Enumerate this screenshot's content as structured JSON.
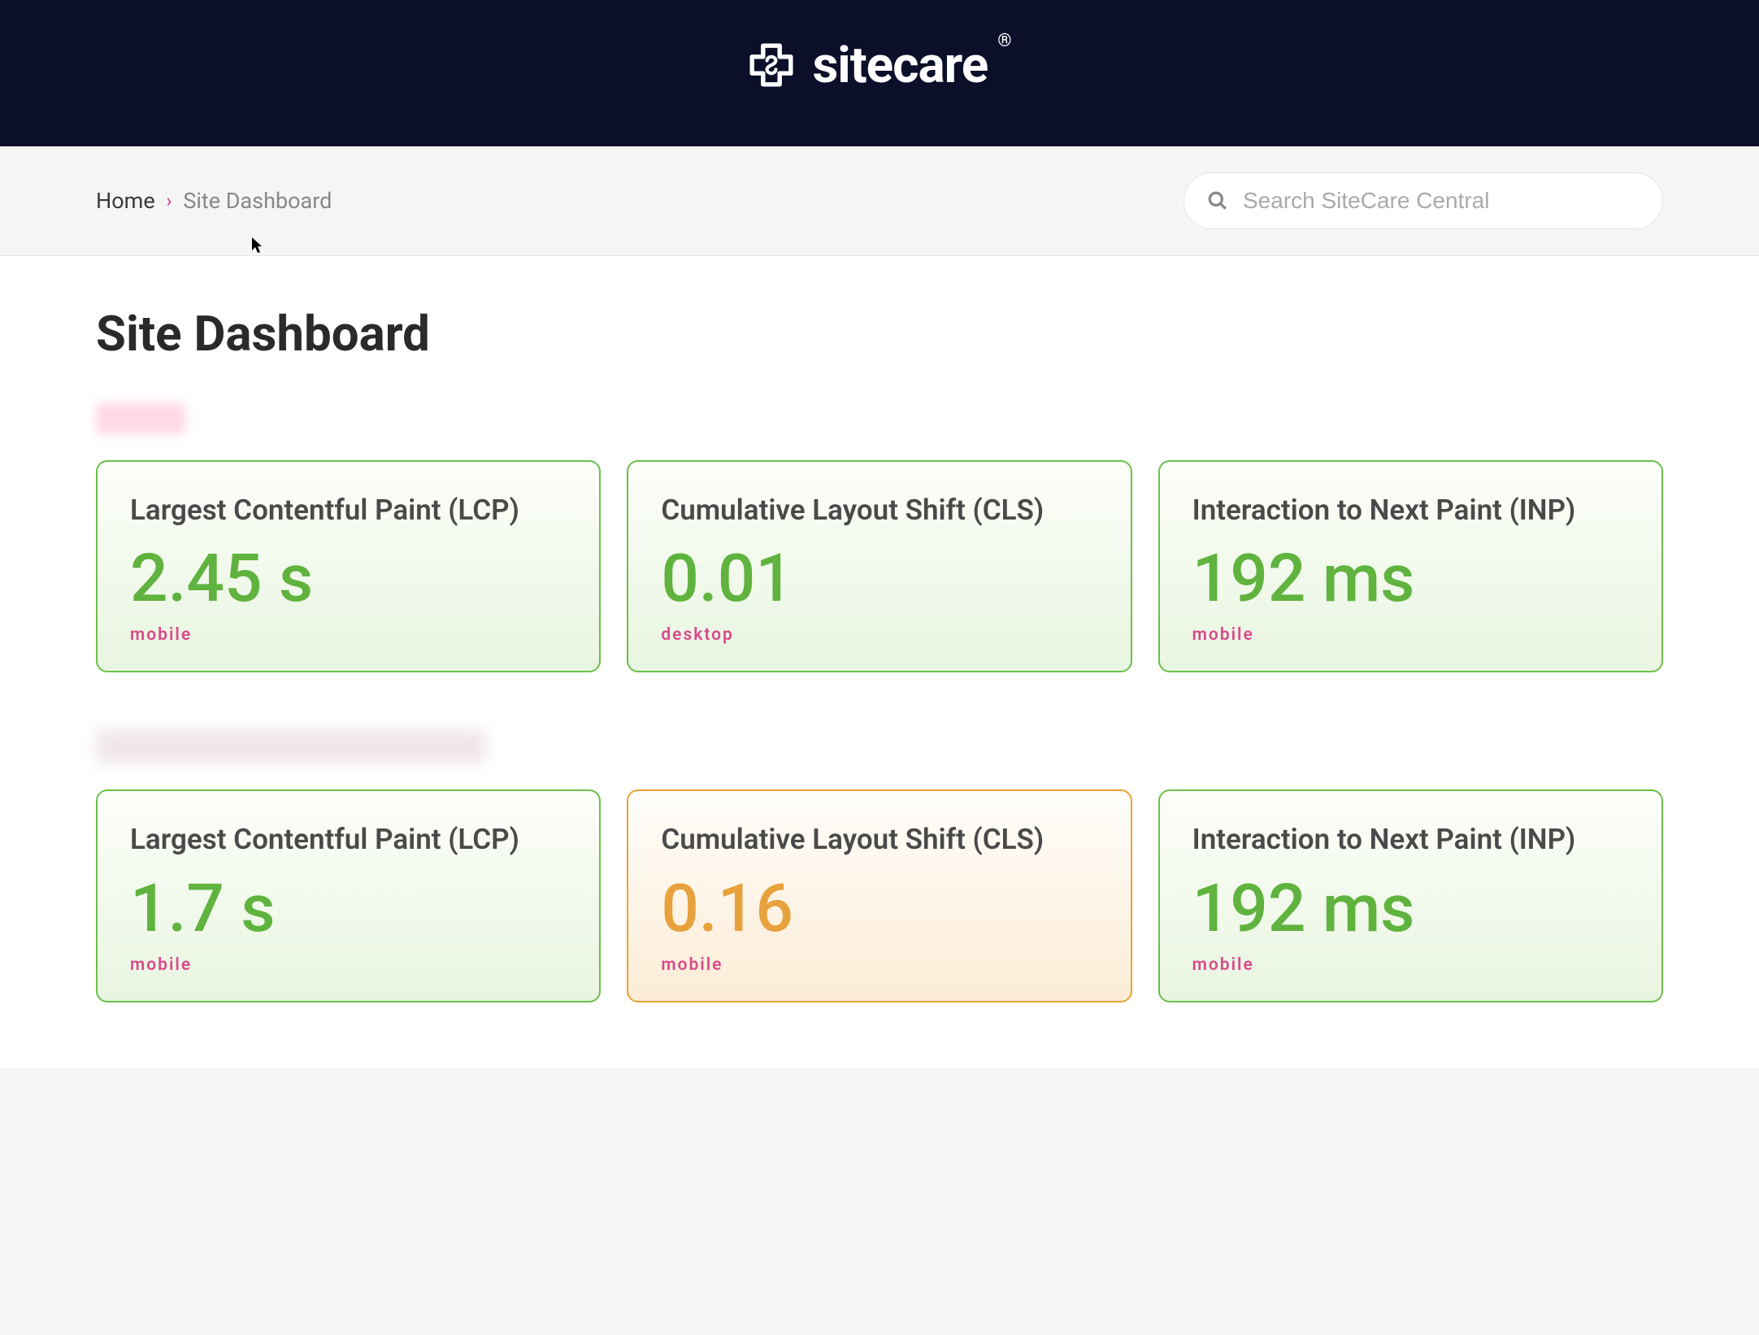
{
  "brand": {
    "name": "sitecare"
  },
  "breadcrumb": {
    "home": "Home",
    "current": "Site Dashboard"
  },
  "search": {
    "placeholder": "Search SiteCare Central"
  },
  "page": {
    "title": "Site Dashboard"
  },
  "sections": [
    {
      "cards": [
        {
          "title": "Largest Contentful Paint (LCP)",
          "value": "2.45 s",
          "tag": "mobile",
          "status": "green"
        },
        {
          "title": "Cumulative Layout Shift (CLS)",
          "value": "0.01",
          "tag": "desktop",
          "status": "green"
        },
        {
          "title": "Interaction to Next Paint (INP)",
          "value": "192 ms",
          "tag": "mobile",
          "status": "green"
        }
      ]
    },
    {
      "cards": [
        {
          "title": "Largest Contentful Paint (LCP)",
          "value": "1.7 s",
          "tag": "mobile",
          "status": "green"
        },
        {
          "title": "Cumulative Layout Shift (CLS)",
          "value": "0.16",
          "tag": "mobile",
          "status": "orange"
        },
        {
          "title": "Interaction to Next Paint (INP)",
          "value": "192 ms",
          "tag": "mobile",
          "status": "green"
        }
      ]
    }
  ]
}
